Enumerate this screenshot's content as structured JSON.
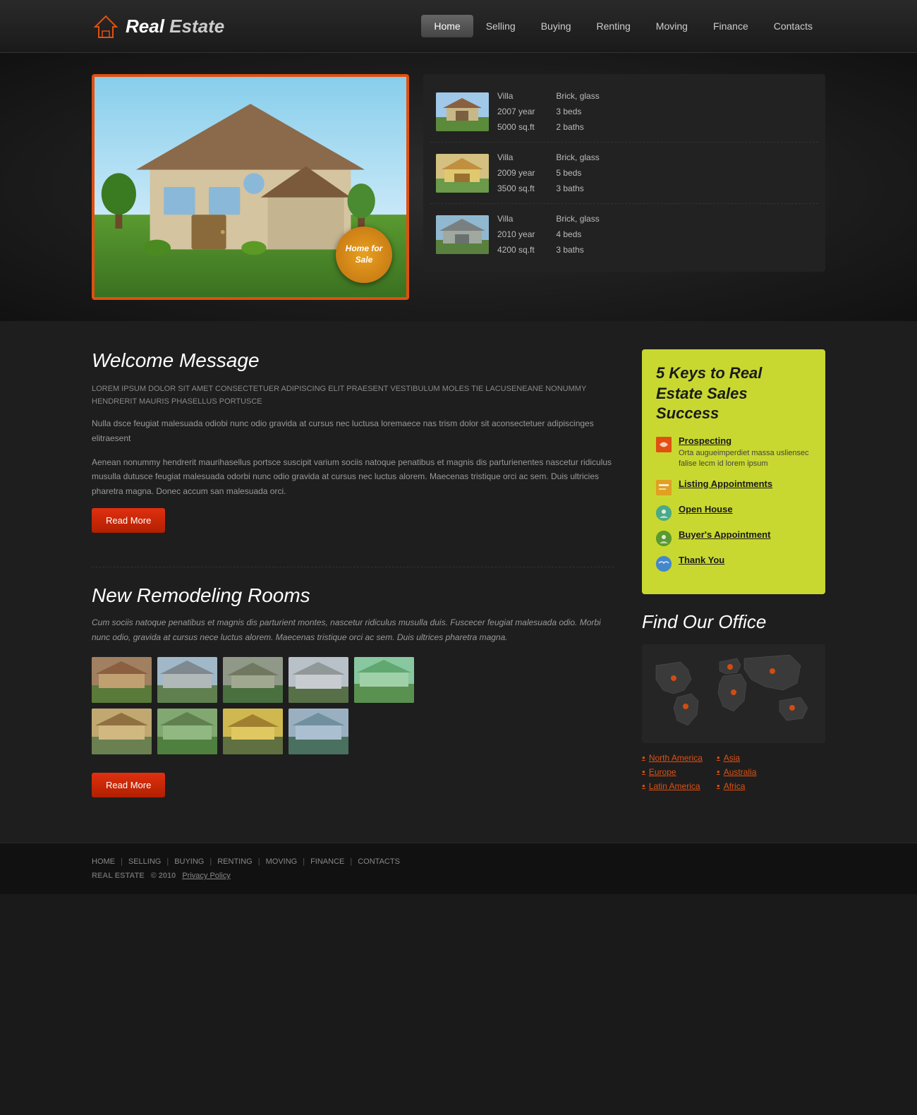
{
  "header": {
    "logo_text_normal": "Real ",
    "logo_text_bold": "Estate",
    "nav": [
      {
        "label": "Home",
        "active": true
      },
      {
        "label": "Selling",
        "active": false
      },
      {
        "label": "Buying",
        "active": false
      },
      {
        "label": "Renting",
        "active": false
      },
      {
        "label": "Moving",
        "active": false
      },
      {
        "label": "Finance",
        "active": false
      },
      {
        "label": "Contacts",
        "active": false
      }
    ]
  },
  "hero": {
    "badge_text": "Home for Sale",
    "listings": [
      {
        "type": "Villa",
        "year": "2007 year",
        "sqft": "5000 sq.ft",
        "material": "Brick, glass",
        "beds": "3 beds",
        "baths": "2 baths"
      },
      {
        "type": "Villa",
        "year": "2009 year",
        "sqft": "3500 sq.ft",
        "material": "Brick, glass",
        "beds": "5 beds",
        "baths": "3 baths"
      },
      {
        "type": "Villa",
        "year": "2010 year",
        "sqft": "4200 sq.ft",
        "material": "Brick, glass",
        "beds": "4 beds",
        "baths": "3 baths"
      }
    ]
  },
  "welcome": {
    "title": "Welcome Message",
    "text_upper": "LOREM IPSUM DOLOR SIT AMET CONSECTETUER ADIPISCING ELIT PRAESENT VESTIBULUM MOLES TIE LACUSENEANE NONUMMY HENDRERIT MAURIS PHASELLUS PORTUSCE",
    "text1": "Nulla dsce feugiat malesuada odiobi nunc odio gravida at cursus nec luctusa loremaece nas trism dolor sit aconsectetuer adipiscinges elitraesent",
    "text2": "Aenean nonummy hendrerit maurihasellus portsce suscipit varium sociis natoque penatibus et magnis dis parturienentes nascetur ridiculus musulla dutusce feugiat malesuada odorbi nunc odio gravida at cursus nec luctus alorem. Maecenas tristique orci ac sem. Duis ultricies pharetra magna. Donec accum san malesuada orci.",
    "read_more": "Read More"
  },
  "keys": {
    "title": "5 Keys to Real Estate Sales Success",
    "items": [
      {
        "label": "Prospecting",
        "desc": "Orta augueimperdiet massa usliensec falise lecm id lorem ipsum",
        "icon_color": "orange"
      },
      {
        "label": "Listing Appointments",
        "desc": "",
        "icon_color": "yellow"
      },
      {
        "label": "Open House",
        "desc": "",
        "icon_color": "teal"
      },
      {
        "label": "Buyer's Appointment",
        "desc": "",
        "icon_color": "green2"
      },
      {
        "label": "Thank You",
        "desc": "",
        "icon_color": "blue"
      }
    ]
  },
  "find_office": {
    "title": "Find Our Office",
    "locations_col1": [
      "North America",
      "Europe",
      "Latin America"
    ],
    "locations_col2": [
      "Asia",
      "Australia",
      "Africa"
    ]
  },
  "remodeling": {
    "title": "New Remodeling Rooms",
    "text": "Cum sociis natoque penatibus et magnis dis parturient montes, nascetur ridiculus musulla duis. Fuscecer feugiat malesuada odio. Morbi nunc odio, gravida at cursus nece luctus alorem. Maecenas tristique orci ac sem. Duis ultrices pharetra magna.",
    "read_more": "Read More",
    "gallery_row1": [
      {
        "alt": "house1"
      },
      {
        "alt": "house2"
      },
      {
        "alt": "house3"
      },
      {
        "alt": "house4"
      },
      {
        "alt": "house5"
      }
    ],
    "gallery_row2": [
      {
        "alt": "house6"
      },
      {
        "alt": "house7"
      },
      {
        "alt": "house8"
      },
      {
        "alt": "house9"
      }
    ]
  },
  "footer": {
    "links": [
      "HOME",
      "SELLING",
      "BUYING",
      "RENTING",
      "MOVING",
      "FINANCE",
      "CONTACTS"
    ],
    "copyright": "REAL ESTATE",
    "year": "© 2010",
    "privacy": "Privacy Policy"
  }
}
